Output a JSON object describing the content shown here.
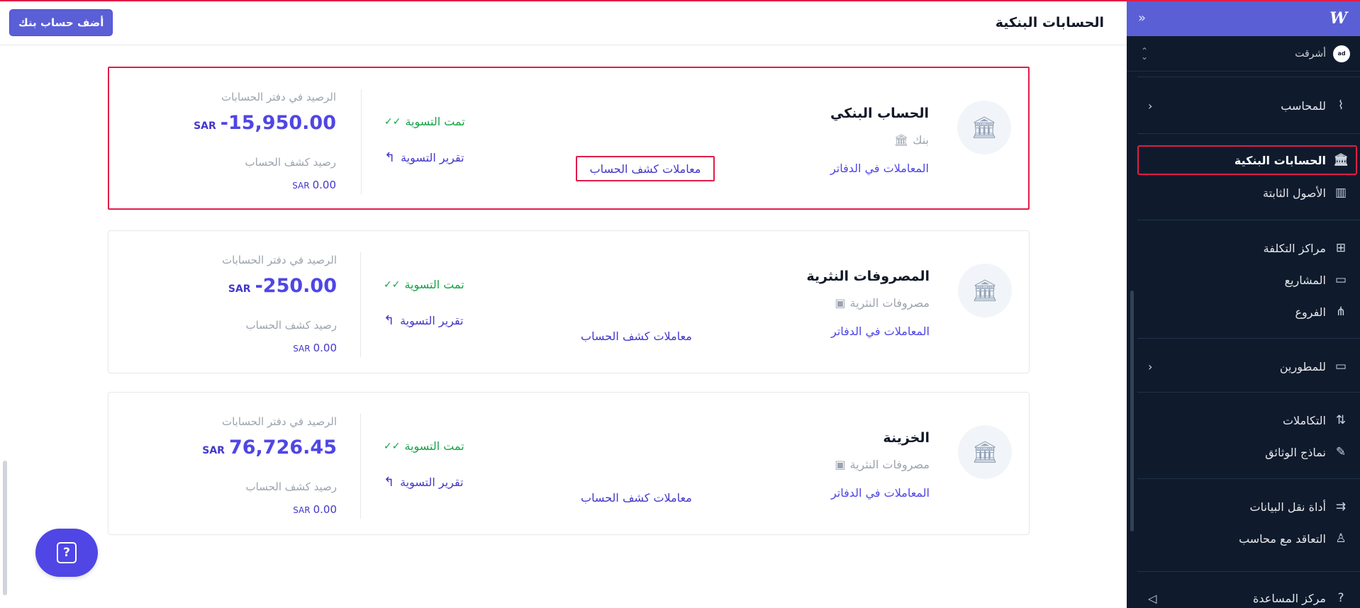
{
  "header": {
    "title": "الحسابات البنكية",
    "add_button": "أضف حساب بنك"
  },
  "sidebar": {
    "logo": "W",
    "collapse_icon": "double-chevron-icon",
    "org_name": "أشرقت",
    "org_avatar": "ad",
    "items": [
      {
        "label": "للمحاسب",
        "icon": "sparkle-chart-icon",
        "chevron": "‹"
      },
      {
        "label": "الحسابات البنكية",
        "icon": "bank-icon",
        "active": true
      },
      {
        "label": "الأصول الثابتة",
        "icon": "building-icon"
      },
      {
        "label": "مراكز التكلفة",
        "icon": "grid-plus-icon"
      },
      {
        "label": "المشاريع",
        "icon": "folder-icon"
      },
      {
        "label": "الفروع",
        "icon": "branches-icon"
      },
      {
        "label": "للمطورين",
        "icon": "terminal-icon",
        "chevron": "‹"
      },
      {
        "label": "التكاملات",
        "icon": "integrations-icon"
      },
      {
        "label": "نماذج الوثائق",
        "icon": "document-edit-icon"
      },
      {
        "label": "أداة نقل البيانات",
        "icon": "data-transfer-icon"
      },
      {
        "label": "التعاقد مع محاسب",
        "icon": "accountant-icon"
      },
      {
        "label": "مركز المساعدة",
        "icon": "help-icon",
        "extra_icon": "megaphone-icon"
      }
    ]
  },
  "accounts": [
    {
      "name": "الحساب البنكي",
      "type": "بنك",
      "type_icon": "bank-small-icon",
      "ledger_link": "المعاملات في الدفاتر",
      "statement_link": "معاملات كشف الحساب",
      "status": "تمت التسوية",
      "report_link": "تقرير التسوية",
      "ledger_balance_label": "الرصيد في دفتر الحسابات",
      "ledger_balance": "-15,950.00",
      "currency": "SAR",
      "statement_balance_label": "رصيد كشف الحساب",
      "statement_balance": "0.00"
    },
    {
      "name": "المصروفات النثرية",
      "type": "مصروفات النثرية",
      "type_icon": "cash-icon",
      "ledger_link": "المعاملات في الدفاتر",
      "statement_link": "معاملات كشف الحساب",
      "status": "تمت التسوية",
      "report_link": "تقرير التسوية",
      "ledger_balance_label": "الرصيد في دفتر الحسابات",
      "ledger_balance": "-250.00",
      "currency": "SAR",
      "statement_balance_label": "رصيد كشف الحساب",
      "statement_balance": "0.00"
    },
    {
      "name": "الخزينة",
      "type": "مصروفات النثرية",
      "type_icon": "cash-icon",
      "ledger_link": "المعاملات في الدفاتر",
      "statement_link": "معاملات كشف الحساب",
      "status": "تمت التسوية",
      "report_link": "تقرير التسوية",
      "ledger_balance_label": "الرصيد في دفتر الحسابات",
      "ledger_balance": "76,726.45",
      "currency": "SAR",
      "statement_balance_label": "رصيد كشف الحساب",
      "statement_balance": "0.00"
    }
  ],
  "help_fab": "help-icon",
  "colors": {
    "accent": "#5b5fd6",
    "sidebar_bg": "#0f1b2d",
    "success": "#16a34a",
    "highlight": "#e11d48"
  }
}
